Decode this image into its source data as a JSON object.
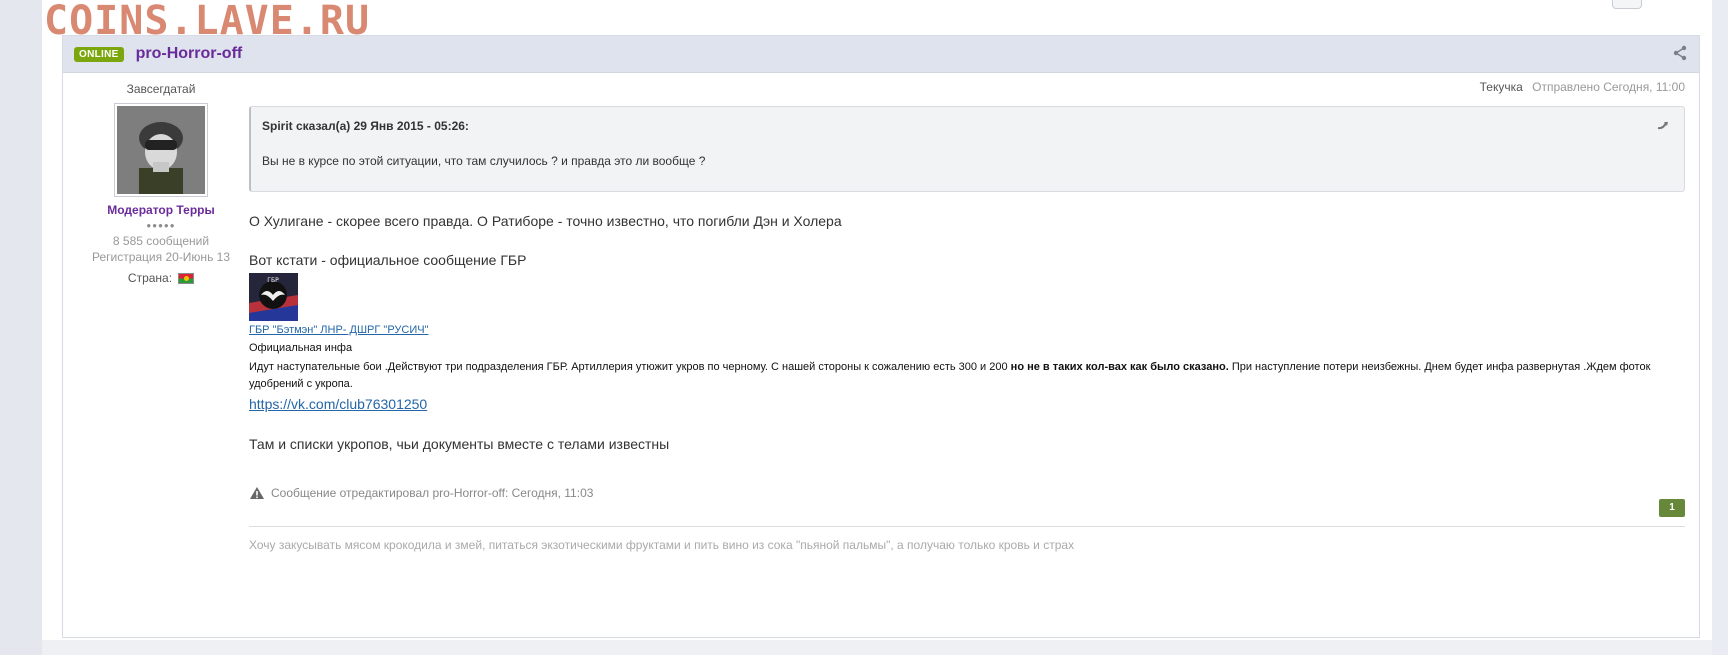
{
  "watermark": "COINS.LAVE.RU",
  "post": {
    "online_badge": "ONLINE",
    "author": "pro-Horror-off",
    "author_panel": {
      "rank_title": "Завсегдатай",
      "group": "Модератор Терры",
      "posts": "8 585 сообщений",
      "registered": "Регистрация 20-Июнь 13",
      "country_label": "Страна:"
    },
    "meta": {
      "topic": "Текучка",
      "sent": "Отправлено Сегодня, 11:00"
    },
    "quote": {
      "cite": "Spirit сказал(а) 29 Янв 2015 - 05:26:",
      "text": "Вы не в курсе по этой ситуации, что там случилось ? и правда это ли вообще ?"
    },
    "body": {
      "p1": "О Хулигане - скорее всего правда. О Ратиборе - точно известно, что погибли Дэн и Холера",
      "p2": "Вот кстати - официальное сообщение ГБР",
      "gbr_link": "ГБР \"Бэтмэн\" ЛНР- ДШРГ \"РУСИЧ\"",
      "official": "Официальная инфа",
      "report_part1": "Идут наступательные бои .Действуют три подразделения ГБР. Артиллерия утюжит укров по черному. С нашей стороны к сожалению есть 300 и 200 ",
      "report_bold": "но не в таких кол-вах как было сказано.",
      "report_part2": " При наступление потери неизбежны. Днем будет инфа развернутая .Ждем фоток удобрений с укропа.",
      "vk_link": "https://vk.com/club76301250",
      "p3": "Там и списки укропов, чьи документы вместе с телами известны"
    },
    "edit_note": "Сообщение отредактировал pro-Horror-off: Сегодня, 11:03",
    "reputation": "1",
    "signature": "Хочу закусывать мясом крокодила и змей, питаться экзотическими фруктами и пить вино из сока \"пьяной пальмы\", а получаю только кровь и страх"
  }
}
